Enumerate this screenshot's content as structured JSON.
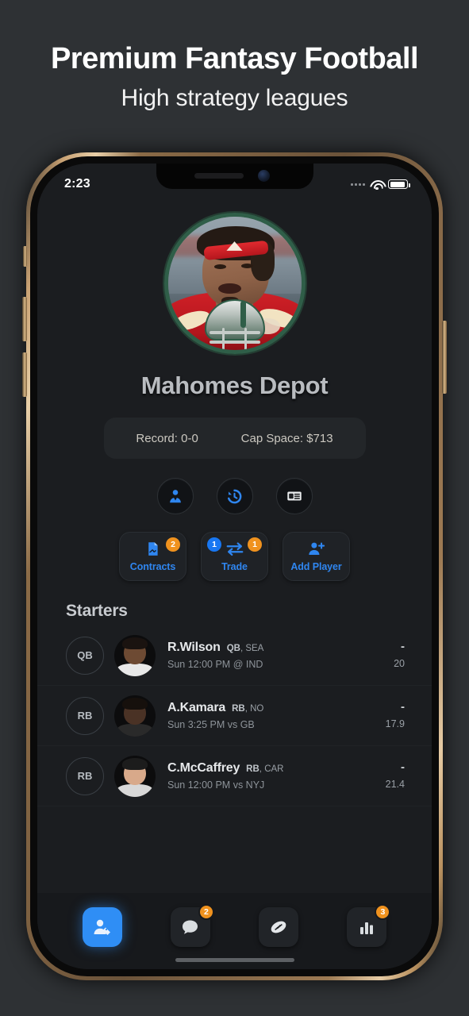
{
  "promo": {
    "title": "Premium Fantasy Football",
    "subtitle": "High strategy leagues"
  },
  "status_bar": {
    "time": "2:23",
    "signal_icon": "signal-dots-icon",
    "wifi_icon": "wifi-icon",
    "battery_icon": "battery-icon"
  },
  "team": {
    "avatar_name": "team-avatar",
    "name": "Mahomes Depot",
    "record_label": "Record: 0-0",
    "cap_space_label": "Cap Space: $713"
  },
  "quick_actions": [
    {
      "name": "manager-icon",
      "label": "Manager"
    },
    {
      "name": "history-icon",
      "label": "History"
    },
    {
      "name": "news-list-icon",
      "label": "News"
    }
  ],
  "action_buttons": [
    {
      "label": "Contracts",
      "icon": "contract-document-icon",
      "badge_right": "2",
      "badge_right_color": "#f0921e",
      "badge_left": null
    },
    {
      "label": "Trade",
      "icon": "trade-arrows-icon",
      "badge_left": "1",
      "badge_left_color": "#1877f2",
      "badge_right": "1",
      "badge_right_color": "#f0921e"
    },
    {
      "label": "Add Player",
      "icon": "add-player-icon",
      "badge_left": null,
      "badge_right": null
    }
  ],
  "starters": {
    "title": "Starters",
    "players": [
      {
        "position": "QB",
        "name": "R.Wilson",
        "pos_team": "QB, SEA",
        "pos_abbr": "QB",
        "team_abbr": "SEA",
        "game": "Sun 12:00 PM @ IND",
        "score": "-",
        "projection": "20"
      },
      {
        "position": "RB",
        "name": "A.Kamara",
        "pos_team": "RB, NO",
        "pos_abbr": "RB",
        "team_abbr": "NO",
        "game": "Sun 3:25 PM vs GB",
        "score": "-",
        "projection": "17.9"
      },
      {
        "position": "RB",
        "name": "C.McCaffrey",
        "pos_team": "RB, CAR",
        "pos_abbr": "RB",
        "team_abbr": "CAR",
        "game": "Sun 12:00 PM vs NYJ",
        "score": "-",
        "projection": "21.4"
      }
    ]
  },
  "tab_bar": [
    {
      "name": "roster-tab",
      "icon": "player-tag-icon",
      "active": true,
      "badge": null
    },
    {
      "name": "chat-tab",
      "icon": "chat-bubble-icon",
      "active": false,
      "badge": "2"
    },
    {
      "name": "league-tab",
      "icon": "football-icon",
      "active": false,
      "badge": null
    },
    {
      "name": "stats-tab",
      "icon": "bar-chart-icon",
      "active": false,
      "badge": "3"
    }
  ],
  "colors": {
    "accent_blue": "#2f86f0",
    "badge_orange": "#f0921e",
    "badge_blue": "#1877f2",
    "page_bg": "#2e3134",
    "screen_bg": "#1b1d20"
  }
}
